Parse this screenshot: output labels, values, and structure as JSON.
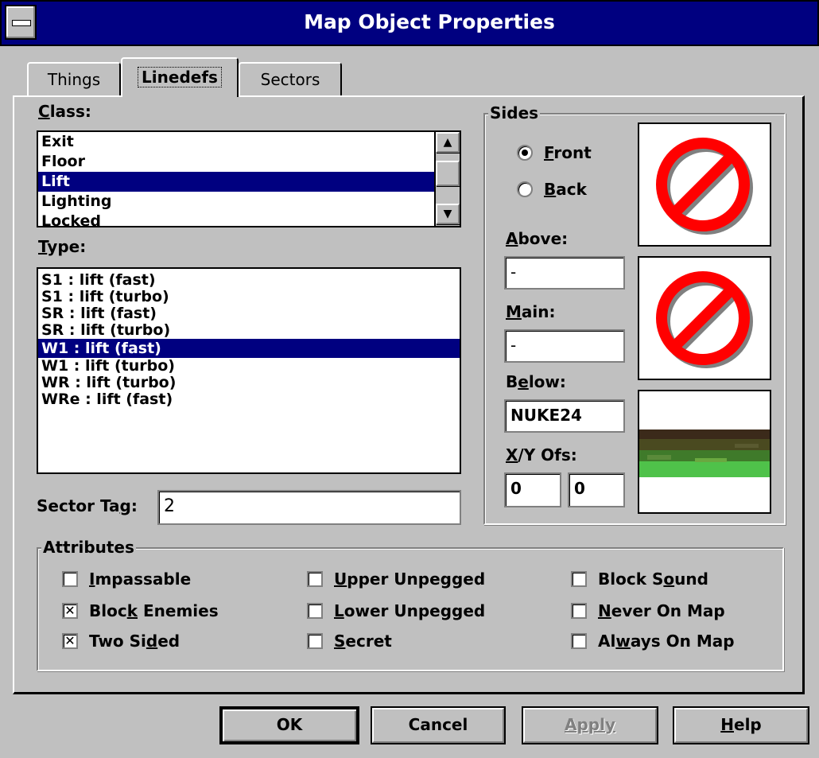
{
  "window": {
    "title": "Map Object Properties"
  },
  "tabs": [
    {
      "label": "Things"
    },
    {
      "label": "Linedefs"
    },
    {
      "label": "Sectors"
    }
  ],
  "class_section": {
    "label": "Class:",
    "items": [
      "Exit",
      "Floor",
      "Lift",
      "Lighting",
      "Locked"
    ],
    "selected": "Lift"
  },
  "type_section": {
    "label": "Type:",
    "items": [
      "S1 : lift (fast)",
      "S1 : lift (turbo)",
      "SR : lift (fast)",
      "SR : lift (turbo)",
      "W1 : lift (fast)",
      "W1 : lift (turbo)",
      "WR : lift (turbo)",
      "WRe : lift (fast)"
    ],
    "selected": "W1 : lift (fast)"
  },
  "sector_tag": {
    "label": "Sector Tag:",
    "value": "2"
  },
  "sides": {
    "title": "Sides",
    "front_label": "Front",
    "back_label": "Back",
    "front_selected": true,
    "above_label": "Above:",
    "above_value": "-",
    "main_label": "Main:",
    "main_value": "-",
    "below_label": "Below:",
    "below_value": "NUKE24",
    "xy_label": "X/Y Ofs:",
    "x_value": "0",
    "y_value": "0"
  },
  "attributes": {
    "title": "Attributes",
    "items": [
      {
        "label": "Impassable",
        "checked": false
      },
      {
        "label": "Block Enemies",
        "checked": true
      },
      {
        "label": "Two Sided",
        "checked": true
      },
      {
        "label": "Upper Unpegged",
        "checked": false
      },
      {
        "label": "Lower Unpegged",
        "checked": false
      },
      {
        "label": "Secret",
        "checked": false
      },
      {
        "label": "Block Sound",
        "checked": false
      },
      {
        "label": "Never On Map",
        "checked": false
      },
      {
        "label": "Always On Map",
        "checked": false
      }
    ]
  },
  "buttons": {
    "ok": "OK",
    "cancel": "Cancel",
    "apply": "Apply",
    "help": "Help"
  },
  "colors": {
    "titlebar": "#000080",
    "face": "#c0c0c0",
    "selection": "#000080"
  }
}
